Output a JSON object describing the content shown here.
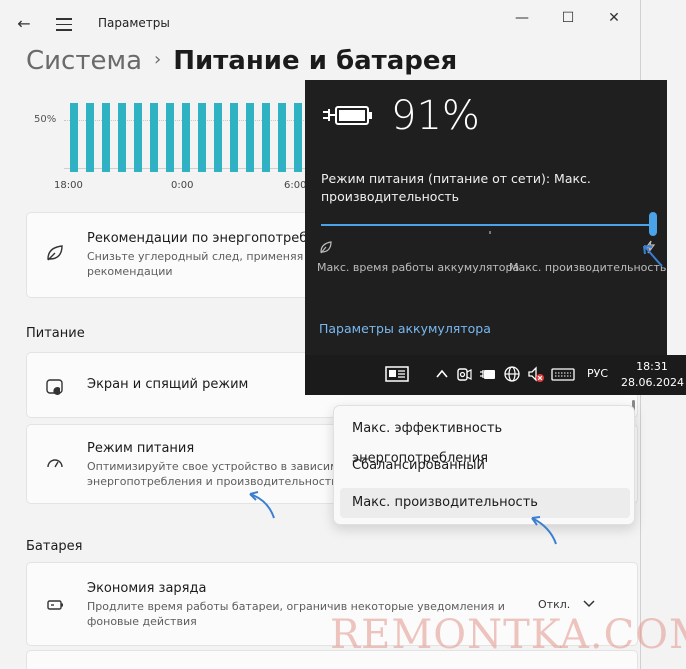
{
  "window": {
    "title": "Параметры",
    "controls": {
      "minimize": "—",
      "maximize": "☐",
      "close": "✕"
    }
  },
  "breadcrumb": {
    "parent": "Система",
    "separator": "›",
    "current": "Питание и батарея"
  },
  "usage_chart": {
    "chart_data": {
      "type": "bar",
      "y_tick_labels": [
        "50%"
      ],
      "x_tick_labels": [
        "18:00",
        "0:00",
        "6:00"
      ],
      "values": [
        0.72,
        0.72,
        0.72,
        0.72,
        0.72,
        0.72,
        0.72,
        0.72,
        0.72,
        0.72,
        0.72,
        0.72,
        0.72,
        0.72,
        0.72,
        0.72,
        0.72
      ],
      "color": "#2fb3c3"
    }
  },
  "recommendations": {
    "title": "Рекомендации по энергопотребле",
    "desc": "Снизьте углеродный след, применяя эт рекомендации"
  },
  "sections": {
    "power": "Питание",
    "battery": "Батарея"
  },
  "screen_sleep": {
    "title": "Экран и спящий режим"
  },
  "power_mode": {
    "title": "Режим питания",
    "desc": "Оптимизируйте свое устройство в зависимо энергопотребления и производительности"
  },
  "battery_saver": {
    "title": "Экономия заряда",
    "desc": "Продлите время работы батареи, ограничив некоторые уведомления и фоновые действия",
    "state": "Откл."
  },
  "flyout": {
    "percent": "91%",
    "mode_text": "Режим питания (питание от сети): Макс. производительность",
    "slider_value": 1.0,
    "slider_left_label": "Макс. время работы аккумулятора",
    "slider_right_label": "Макс. производительность",
    "link": "Параметры аккумулятора",
    "accent": "#4aa3e8"
  },
  "taskbar": {
    "icons": [
      "news-icon",
      "chevron-up-icon",
      "camera-icon",
      "battery-plug-icon",
      "globe-icon",
      "volume-muted-icon",
      "keyboard-icon"
    ],
    "language": "РУС",
    "time": "18:31",
    "date": "28.06.2024"
  },
  "dropdown": {
    "options": [
      "Макс. эффективность энергопотребления",
      "Сбалансированный",
      "Макс. производительность"
    ],
    "selected_index": 2
  },
  "watermark": "REMONTKA.COM"
}
